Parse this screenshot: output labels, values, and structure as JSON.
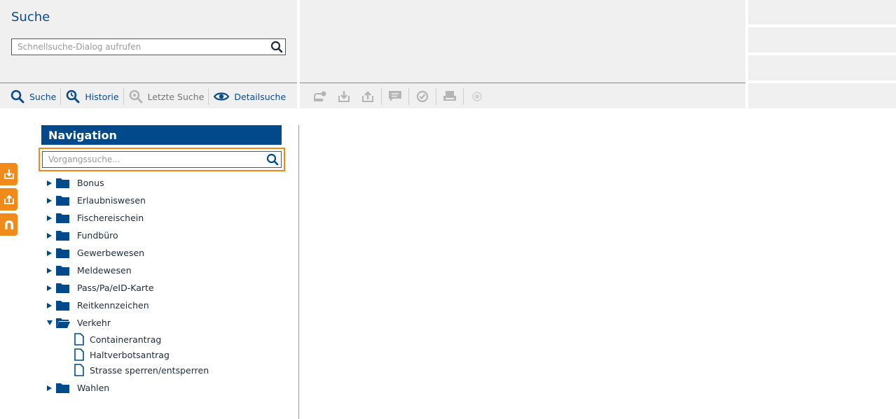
{
  "search": {
    "title": "Suche",
    "quick_placeholder": "Schnellsuche-Dialog aufrufen"
  },
  "toolbar": {
    "suche": "Suche",
    "historie": "Historie",
    "letzte_suche": "Letzte Suche",
    "detailsuche": "Detailsuche"
  },
  "navigation": {
    "title": "Navigation",
    "vorgang_placeholder": "Vorgangssuche...",
    "tree": [
      {
        "label": "Bonus",
        "expanded": false
      },
      {
        "label": "Erlaubniswesen",
        "expanded": false
      },
      {
        "label": "Fischereischein",
        "expanded": false
      },
      {
        "label": "Fundbüro",
        "expanded": false
      },
      {
        "label": "Gewerbewesen",
        "expanded": false
      },
      {
        "label": "Meldewesen",
        "expanded": false
      },
      {
        "label": "Pass/Pa/eID-Karte",
        "expanded": false
      },
      {
        "label": "Reitkennzeichen",
        "expanded": false
      },
      {
        "label": "Verkehr",
        "expanded": true,
        "children": [
          "Containerantrag",
          "Haltverbotsantrag",
          "Strasse sperren/entsperren"
        ]
      },
      {
        "label": "Wahlen",
        "expanded": false
      }
    ]
  },
  "colors": {
    "primary": "#004a8c",
    "accent": "#f08a1a",
    "panel": "#f0f0f0",
    "disabled_icon": "#b5b5b5"
  }
}
